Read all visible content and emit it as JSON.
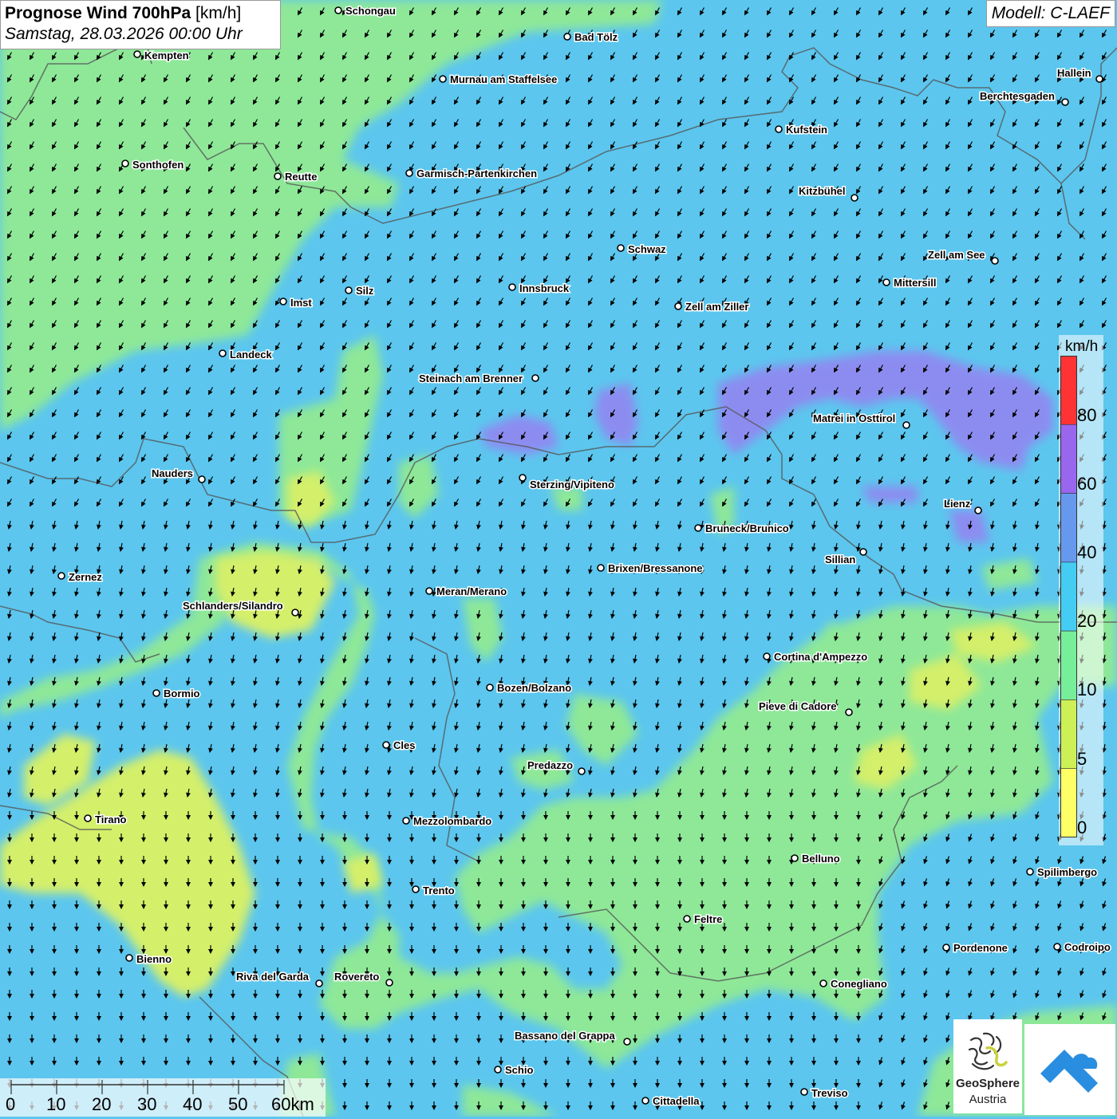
{
  "title": {
    "main": "Prognose Wind 700hPa",
    "unit": "[km/h]",
    "datetime": "Samstag, 28.03.2026 00:00 Uhr"
  },
  "model_label": "Modell: C-LAEF",
  "legend": {
    "unit": "km/h",
    "labels": [
      "80",
      "60",
      "40",
      "20",
      "10",
      "5",
      "0"
    ],
    "bands": [
      {
        "color": "#ff3333"
      },
      {
        "color": "#9966ee"
      },
      {
        "color": "#6699ee"
      },
      {
        "color": "#44ccf2"
      },
      {
        "color": "#77ee99"
      },
      {
        "color": "#ccf055"
      },
      {
        "color": "#ffff66"
      }
    ]
  },
  "scale_bar": {
    "labels": [
      "0",
      "10",
      "20",
      "30",
      "40",
      "50",
      "60km"
    ]
  },
  "logos": {
    "geosphere_name": "GeoSphere",
    "geosphere_country": "Austria"
  },
  "colors": {
    "water_blue": "#5cc6ee",
    "calm_green": "#8ee898",
    "calm_yellow": "#d4ef6a",
    "strong_violet": "#8c8cf0",
    "border": "#555555",
    "app_logo_blue": "#2a8ee0"
  },
  "cities": [
    {
      "name": "Schongau",
      "dot": [
        424,
        13
      ],
      "label": [
        433,
        13
      ]
    },
    {
      "name": "Kempten",
      "dot": [
        172,
        68
      ],
      "label": [
        181,
        69
      ]
    },
    {
      "name": "Bad Tölz",
      "dot": [
        711,
        46
      ],
      "label": [
        720,
        46
      ]
    },
    {
      "name": "Murnau am Staffelsee",
      "dot": [
        555,
        99
      ],
      "label": [
        564,
        99
      ]
    },
    {
      "name": "Hallein",
      "dot": [
        1378,
        99
      ],
      "label": [
        1325,
        91
      ]
    },
    {
      "name": "Berchtesgaden",
      "dot": [
        1335,
        128
      ],
      "label": [
        1228,
        120
      ]
    },
    {
      "name": "Kufstein",
      "dot": [
        976,
        162
      ],
      "label": [
        985,
        162
      ]
    },
    {
      "name": "Sonthofen",
      "dot": [
        157,
        205
      ],
      "label": [
        166,
        206
      ]
    },
    {
      "name": "Reutte",
      "dot": [
        348,
        221
      ],
      "label": [
        357,
        221
      ]
    },
    {
      "name": "Garmisch-Partenkirchen",
      "dot": [
        513,
        217
      ],
      "label": [
        522,
        217
      ]
    },
    {
      "name": "Kitzbühel",
      "dot": [
        1071,
        248
      ],
      "label": [
        1001,
        239
      ]
    },
    {
      "name": "Schwaz",
      "dot": [
        778,
        311
      ],
      "label": [
        787,
        312
      ]
    },
    {
      "name": "Zell am See",
      "dot": [
        1247,
        327
      ],
      "label": [
        1163,
        319
      ]
    },
    {
      "name": "Innsbruck",
      "dot": [
        642,
        360
      ],
      "label": [
        651,
        361
      ]
    },
    {
      "name": "Mittersill",
      "dot": [
        1111,
        354
      ],
      "label": [
        1120,
        354
      ]
    },
    {
      "name": "Silz",
      "dot": [
        437,
        364
      ],
      "label": [
        446,
        364
      ]
    },
    {
      "name": "Imst",
      "dot": [
        355,
        378
      ],
      "label": [
        364,
        379
      ]
    },
    {
      "name": "Zell am Ziller",
      "dot": [
        850,
        384
      ],
      "label": [
        859,
        384
      ]
    },
    {
      "name": "Landeck",
      "dot": [
        279,
        443
      ],
      "label": [
        288,
        444
      ]
    },
    {
      "name": "Steinach am Brenner",
      "dot": [
        671,
        474
      ],
      "label": [
        525,
        474
      ]
    },
    {
      "name": "Matrei in Osttirol",
      "dot": [
        1136,
        533
      ],
      "label": [
        1019,
        524
      ]
    },
    {
      "name": "Nauders",
      "dot": [
        253,
        601
      ],
      "label": [
        190,
        593
      ]
    },
    {
      "name": "Sterzing/Vipiteno",
      "dot": [
        655,
        599
      ],
      "label": [
        664,
        607
      ]
    },
    {
      "name": "Lienz",
      "dot": [
        1226,
        640
      ],
      "label": [
        1183,
        631
      ]
    },
    {
      "name": "Bruneck/Brunico",
      "dot": [
        875,
        662
      ],
      "label": [
        884,
        662
      ]
    },
    {
      "name": "Sillian",
      "dot": [
        1082,
        692
      ],
      "label": [
        1034,
        701
      ]
    },
    {
      "name": "Brixen/Bressanone",
      "dot": [
        753,
        712
      ],
      "label": [
        762,
        712
      ]
    },
    {
      "name": "Zernez",
      "dot": [
        77,
        722
      ],
      "label": [
        86,
        723
      ]
    },
    {
      "name": "Meran/Merano",
      "dot": [
        538,
        741
      ],
      "label": [
        547,
        741
      ]
    },
    {
      "name": "Schlanders/Silandro",
      "dot": [
        370,
        768
      ],
      "label": [
        229,
        759
      ]
    },
    {
      "name": "Cortina d'Ampezzo",
      "dot": [
        961,
        823
      ],
      "label": [
        970,
        823
      ]
    },
    {
      "name": "Bozen/Bolzano",
      "dot": [
        614,
        862
      ],
      "label": [
        623,
        862
      ]
    },
    {
      "name": "Bormio",
      "dot": [
        196,
        869
      ],
      "label": [
        205,
        869
      ]
    },
    {
      "name": "Pieve di Cadore",
      "dot": [
        1064,
        893
      ],
      "label": [
        951,
        885
      ]
    },
    {
      "name": "Cles",
      "dot": [
        484,
        934
      ],
      "label": [
        493,
        934
      ]
    },
    {
      "name": "Predazzo",
      "dot": [
        729,
        967
      ],
      "label": [
        661,
        959
      ]
    },
    {
      "name": "Tirano",
      "dot": [
        110,
        1026
      ],
      "label": [
        119,
        1027
      ]
    },
    {
      "name": "Mezzolombardo",
      "dot": [
        509,
        1029
      ],
      "label": [
        518,
        1029
      ]
    },
    {
      "name": "Belluno",
      "dot": [
        996,
        1076
      ],
      "label": [
        1005,
        1076
      ]
    },
    {
      "name": "Spilimbergo",
      "dot": [
        1291,
        1093
      ],
      "label": [
        1300,
        1093
      ]
    },
    {
      "name": "Trento",
      "dot": [
        521,
        1115
      ],
      "label": [
        530,
        1116
      ]
    },
    {
      "name": "Feltre",
      "dot": [
        861,
        1152
      ],
      "label": [
        870,
        1152
      ]
    },
    {
      "name": "Pordenone",
      "dot": [
        1186,
        1188
      ],
      "label": [
        1195,
        1188
      ]
    },
    {
      "name": "Codroipo",
      "dot": [
        1325,
        1187
      ],
      "label": [
        1334,
        1187
      ]
    },
    {
      "name": "Bienno",
      "dot": [
        162,
        1201
      ],
      "label": [
        171,
        1202
      ]
    },
    {
      "name": "Riva del Garda",
      "dot": [
        400,
        1233
      ],
      "label": [
        296,
        1224
      ]
    },
    {
      "name": "Rovereto",
      "dot": [
        488,
        1232
      ],
      "label": [
        419,
        1224
      ]
    },
    {
      "name": "Conegliano",
      "dot": [
        1032,
        1233
      ],
      "label": [
        1041,
        1233
      ]
    },
    {
      "name": "Bassano del Grappa",
      "dot": [
        786,
        1306
      ],
      "label": [
        645,
        1298
      ]
    },
    {
      "name": "Schio",
      "dot": [
        624,
        1341
      ],
      "label": [
        633,
        1341
      ]
    },
    {
      "name": "Treviso",
      "dot": [
        1008,
        1369
      ],
      "label": [
        1017,
        1370
      ]
    },
    {
      "name": "Cittadella",
      "dot": [
        809,
        1380
      ],
      "label": [
        818,
        1380
      ]
    }
  ]
}
